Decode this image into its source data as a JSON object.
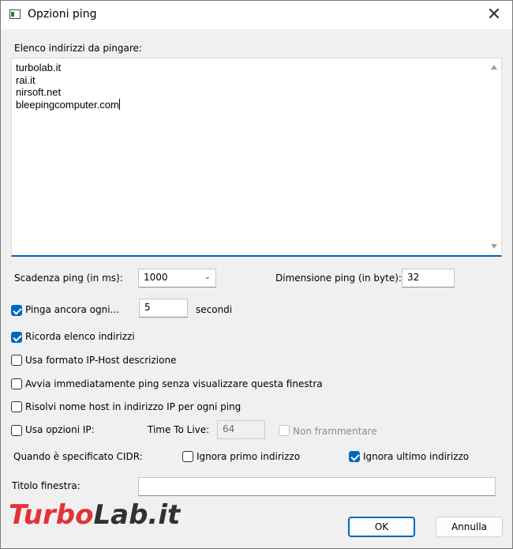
{
  "window": {
    "title": "Opzioni ping",
    "close_glyph": "✕"
  },
  "addresses": {
    "label": "Elenco indirizzi da pingare:",
    "lines": [
      "turbolab.it",
      "rai.it",
      "nirsoft.net",
      "bleepingcomputer.com"
    ]
  },
  "timeout": {
    "label": "Scadenza ping (in ms):",
    "value": "1000"
  },
  "size": {
    "label": "Dimensione ping (in byte):",
    "value": "32"
  },
  "repeat": {
    "label": "Pinga ancora ogni...",
    "checked": true,
    "value": "5",
    "unit": "secondi"
  },
  "options": {
    "remember": {
      "label": "Ricorda elenco indirizzi",
      "checked": true
    },
    "ip_host_format": {
      "label": "Usa formato IP-Host descrizione",
      "checked": false
    },
    "start_immediately": {
      "label": "Avvia immediatamente ping senza visualizzare questa finestra",
      "checked": false
    },
    "resolve_host": {
      "label": "Risolvi nome host in indirizzo IP per ogni ping",
      "checked": false
    }
  },
  "ip_options": {
    "label": "Usa opzioni IP:",
    "checked": false,
    "ttl_label": "Time To Live:",
    "ttl_value": "64",
    "no_fragment_label": "Non frammentare",
    "no_fragment_checked": false
  },
  "cidr": {
    "label": "Quando è specificato CIDR:",
    "ignore_first": {
      "label": "Ignora primo indirizzo",
      "checked": false
    },
    "ignore_last": {
      "label": "Ignora ultimo indirizzo",
      "checked": true
    }
  },
  "window_title_field": {
    "label": "Titolo finestra:",
    "value": ""
  },
  "buttons": {
    "ok": "OK",
    "cancel": "Annulla"
  },
  "watermark": {
    "part1": "Turbo",
    "part2": "Lab.it"
  },
  "colors": {
    "accent": "#0067c0",
    "watermark_red": "#e31e24"
  }
}
